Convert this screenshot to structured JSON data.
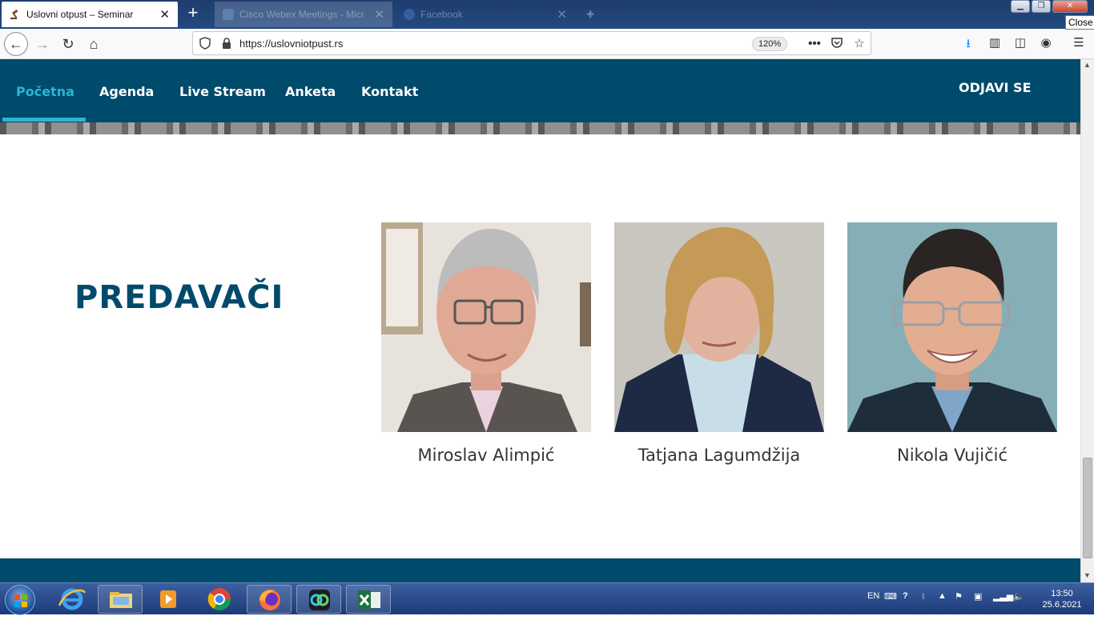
{
  "browser": {
    "active_tab_title": "Uslovni otpust – Seminar",
    "tab2_title": "Cisco Webex Meetings - Micr",
    "tab3_title": "Facebook",
    "new_tab_label": "+",
    "url": "https://uslovniotpust.rs",
    "zoom": "120%",
    "close_tooltip": "Close"
  },
  "site": {
    "nav": [
      "Početna",
      "Agenda",
      "Live Stream",
      "Anketa",
      "Kontakt"
    ],
    "logout": "ODJAVI SE",
    "section_title": "PREDAVAČI",
    "speakers": [
      {
        "name": "Miroslav Alimpić"
      },
      {
        "name": "Tatjana Lagumdžija"
      },
      {
        "name": "Nikola Vujičić"
      }
    ]
  },
  "taskbar": {
    "language": "EN",
    "time": "13:50",
    "date": "25.6.2021"
  },
  "colors": {
    "brand": "#004a6b",
    "accent": "#2bb6d6"
  }
}
